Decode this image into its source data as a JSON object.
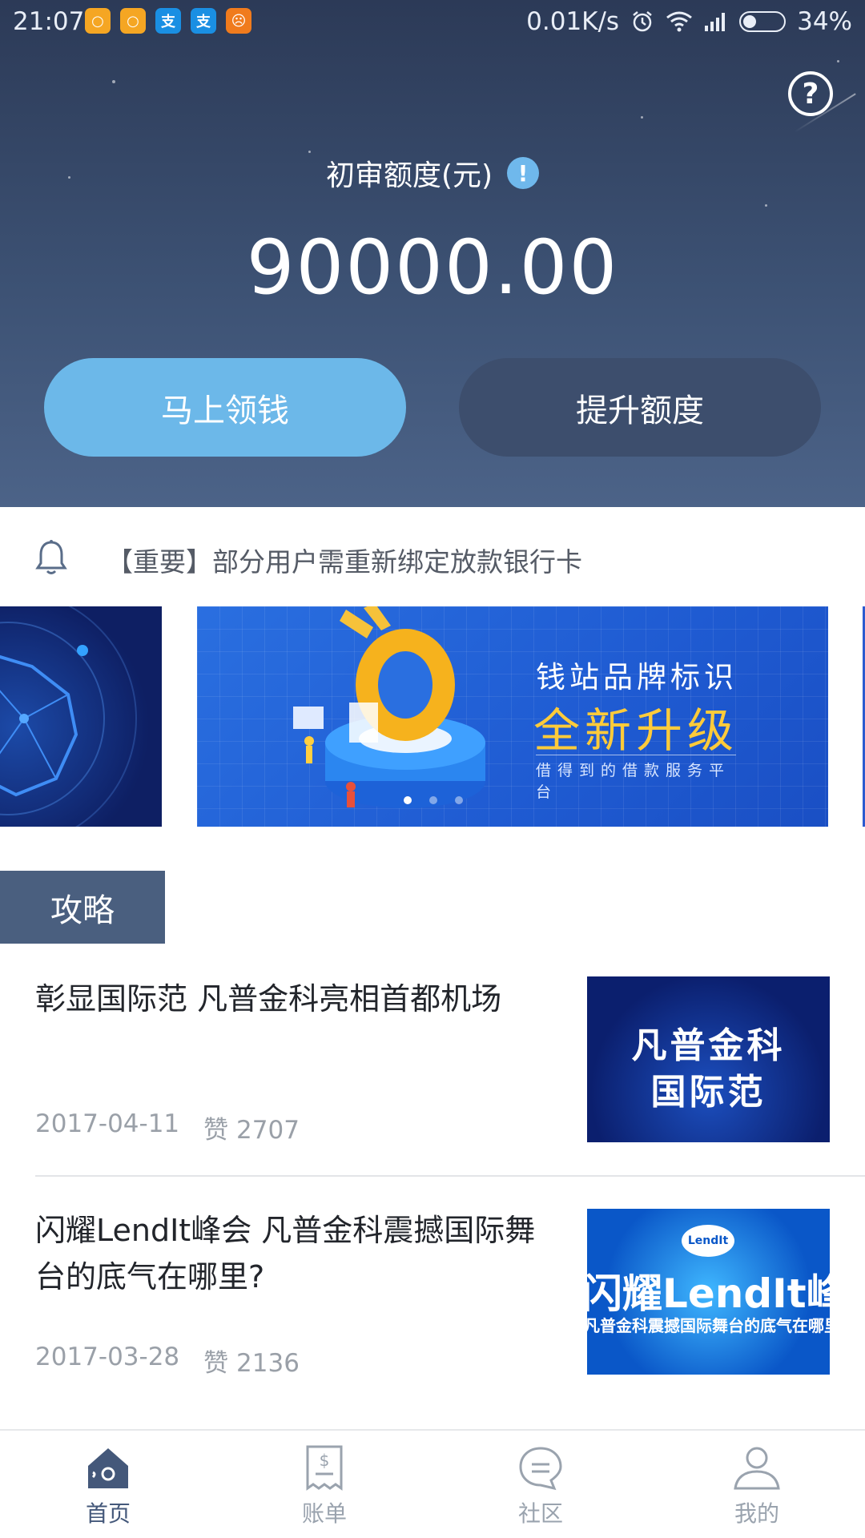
{
  "status_bar": {
    "time": "21:07",
    "network_speed": "0.01K/s",
    "battery_percent": "34%",
    "battery_level": 0.34,
    "app_icons": [
      {
        "name": "notification-app-icon",
        "glyph": "○",
        "color": "#f5a623"
      },
      {
        "name": "notification-app-icon",
        "glyph": "○",
        "color": "#f5a623"
      },
      {
        "name": "alipay-icon",
        "glyph": "支",
        "color": "#1a8fe3"
      },
      {
        "name": "alipay-icon",
        "glyph": "支",
        "color": "#1a8fe3"
      },
      {
        "name": "uc-browser-icon",
        "glyph": "☹",
        "color": "#f07b1d"
      }
    ]
  },
  "hero": {
    "quota_label": "初审额度(元)",
    "amount": "90000.00",
    "primary_button": "马上领钱",
    "secondary_button": "提升额度"
  },
  "notice": {
    "text": "【重要】部分用户需重新绑定放款银行卡"
  },
  "banner": {
    "line1": "钱站品牌标识",
    "line2": "全新升级",
    "line3": "借得到的借款服务平台",
    "slide_count": 3,
    "active_slide": 0
  },
  "section": {
    "tab_label": "攻略"
  },
  "articles": [
    {
      "title": "彰显国际范 凡普金科亮相首都机场",
      "date": "2017-04-11",
      "likes": "赞 2707",
      "thumb_lines": [
        "凡普金科",
        "国际范"
      ]
    },
    {
      "title": "闪耀LendIt峰会 凡普金科震撼国际舞台的底气在哪里?",
      "date": "2017-03-28",
      "likes": "赞 2136",
      "thumb_logo": "LendIt",
      "thumb_title": "闪耀LendIt峰会",
      "thumb_subtitle": "凡普金科震撼国际舞台的底气在哪里"
    }
  ],
  "bottom_nav": [
    {
      "label": "首页",
      "icon": "home-icon",
      "active": true
    },
    {
      "label": "账单",
      "icon": "bill-icon",
      "active": false
    },
    {
      "label": "社区",
      "icon": "community-chat-icon",
      "active": false
    },
    {
      "label": "我的",
      "icon": "profile-icon",
      "active": false
    }
  ],
  "colors": {
    "hero_top": "#2c3a57",
    "hero_bottom": "#4c6388",
    "primary_button": "#6cb8e9",
    "secondary_button": "#3d4e6d",
    "nav_active": "#44587a",
    "nav_inactive": "#9aa3ae",
    "banner_accent": "#ffcb3a"
  }
}
